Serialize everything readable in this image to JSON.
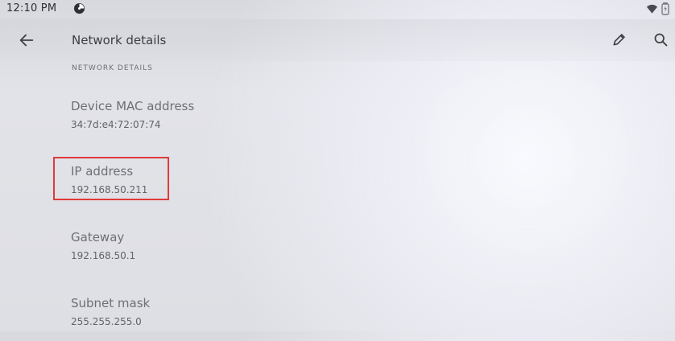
{
  "status_bar": {
    "time": "12:10 PM",
    "icons": [
      "app-status-icon",
      "wifi-icon",
      "battery-icon"
    ]
  },
  "app_bar": {
    "title": "Network details",
    "actions": [
      "back-arrow-icon",
      "edit-icon",
      "search-icon"
    ]
  },
  "content": {
    "section_title": "NETWORK DETAILS",
    "items": [
      {
        "label": "Device MAC address",
        "value": "34:7d:e4:72:07:74"
      },
      {
        "label": "IP address",
        "value": "192.168.50.211"
      },
      {
        "label": "Gateway",
        "value": "192.168.50.1"
      },
      {
        "label": "Subnet mask",
        "value": "255.255.255.0"
      }
    ]
  },
  "colors": {
    "highlight": "#df3a3a",
    "text_primary": "#3c3d42",
    "text_secondary": "#6d6f75"
  }
}
